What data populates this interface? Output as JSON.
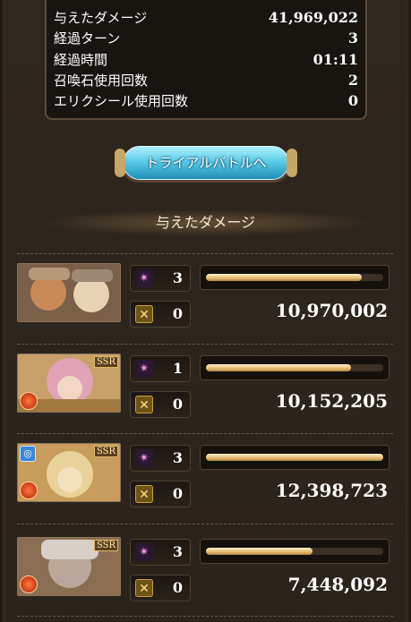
{
  "stats": [
    {
      "label": "与えたダメージ",
      "value": "41,969,022"
    },
    {
      "label": "経過ターン",
      "value": "3"
    },
    {
      "label": "経過時間",
      "value": "01:11"
    },
    {
      "label": "召喚石使用回数",
      "value": "2"
    },
    {
      "label": "エリクシール使用回数",
      "value": "0"
    }
  ],
  "trial_button_label": "トライアルバトルへ",
  "section_title": "与えたダメージ",
  "characters": [
    {
      "skill_count": "3",
      "ougi_count": "0",
      "damage": "10,970,002",
      "damage_fraction": 0.88,
      "ssr": "",
      "colors": [
        "#c98a5a",
        "#b49878",
        "#e7d2b4"
      ]
    },
    {
      "skill_count": "1",
      "ougi_count": "0",
      "damage": "10,152,205",
      "damage_fraction": 0.82,
      "ssr": "SSR",
      "colors": [
        "#e2a3b7",
        "#f2d6c4",
        "#c99a5a"
      ]
    },
    {
      "skill_count": "3",
      "ougi_count": "0",
      "damage": "12,398,723",
      "damage_fraction": 1.0,
      "ssr": "SSR",
      "colors": [
        "#e9d29a",
        "#f3e2bf",
        "#c89c5c"
      ]
    },
    {
      "skill_count": "3",
      "ougi_count": "0",
      "damage": "7,448,092",
      "damage_fraction": 0.6,
      "ssr": "SSR",
      "colors": [
        "#d8d0c8",
        "#b9a89a",
        "#8a6e52"
      ]
    }
  ],
  "icons": {
    "skill": "sparkle-icon",
    "ougi": "crossed-swords-icon",
    "element": "fire-element-icon",
    "badge": "ring-badge-icon"
  }
}
